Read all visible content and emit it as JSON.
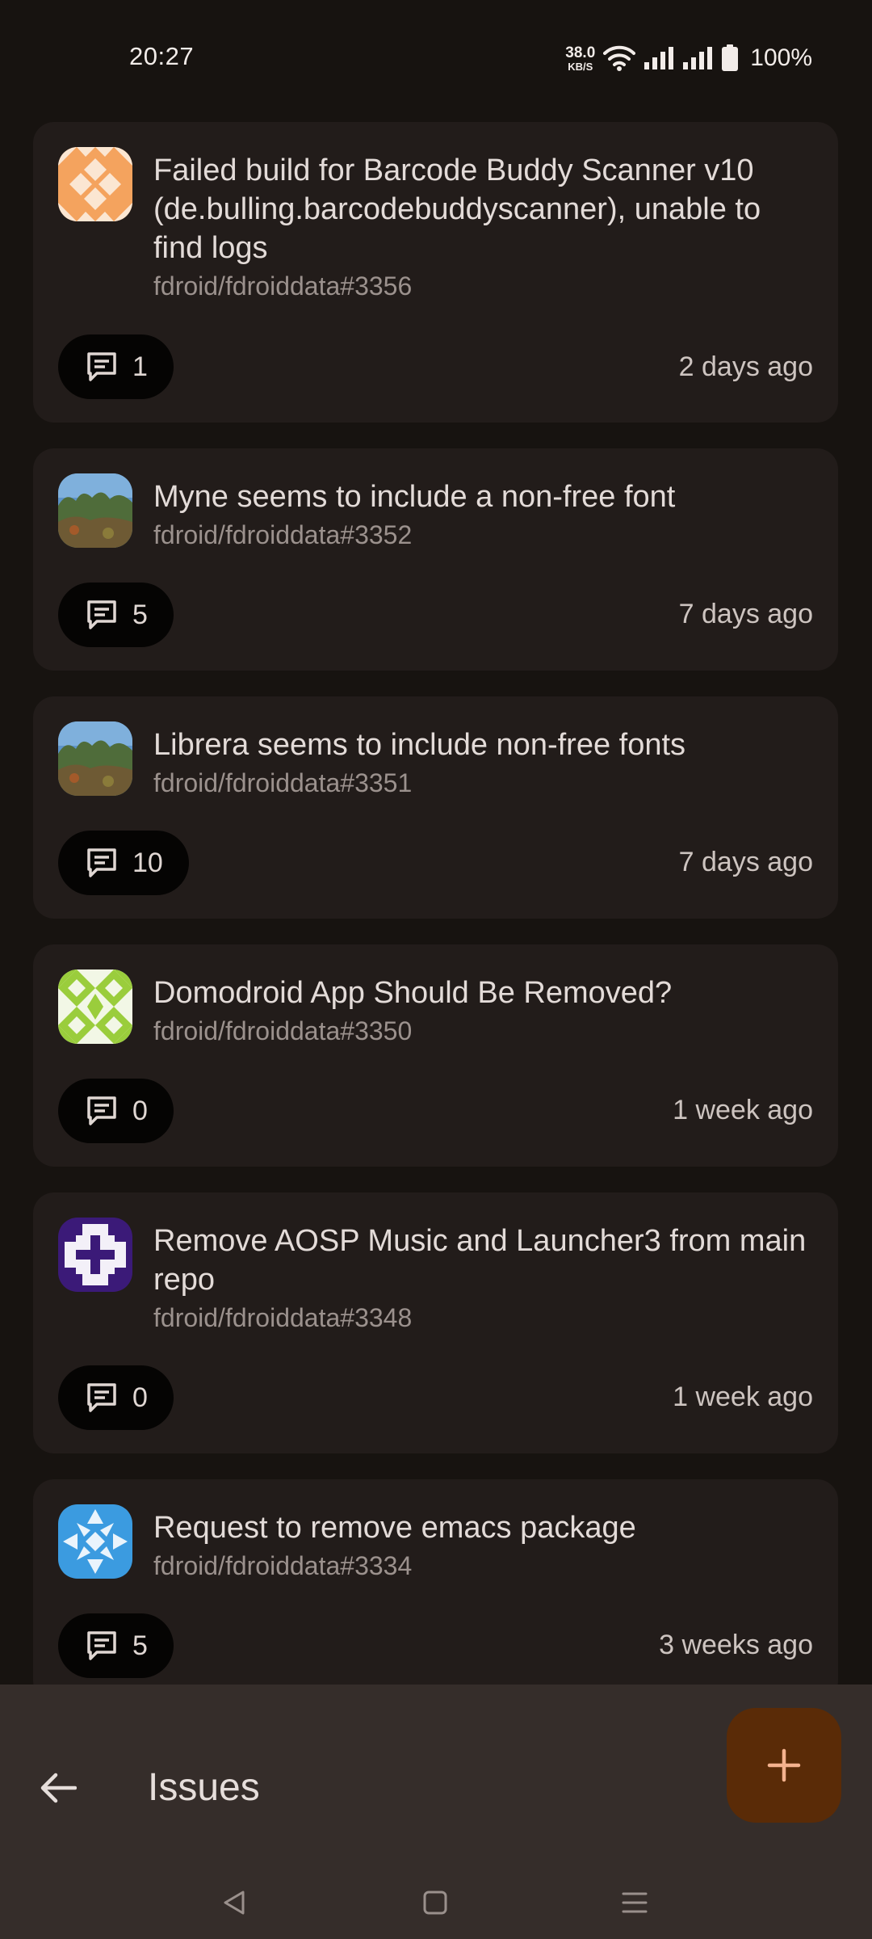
{
  "status_bar": {
    "time": "20:27",
    "net_speed_value": "38.0",
    "net_speed_unit": "KB/S",
    "battery": "100%",
    "icons": [
      "wifi-icon",
      "signal-icon",
      "signal-icon",
      "battery-icon"
    ]
  },
  "issues": [
    {
      "title": "Failed build for Barcode Buddy Scanner v10 (de.bulling.barcodebuddyscanner), unable to find logs",
      "ref": "fdroid/fdroiddata#3356",
      "comments": "1",
      "time": "2 days ago",
      "avatar": "orange-identicon",
      "avatar_color": "#f4a35e"
    },
    {
      "title": "Myne seems to include a non-free font",
      "ref": "fdroid/fdroiddata#3352",
      "comments": "5",
      "time": "7 days ago",
      "avatar": "forest-photo"
    },
    {
      "title": "Librera seems to include non-free fonts",
      "ref": "fdroid/fdroiddata#3351",
      "comments": "10",
      "time": "7 days ago",
      "avatar": "forest-photo"
    },
    {
      "title": "Domodroid App Should Be Removed?",
      "ref": "fdroid/fdroiddata#3350",
      "comments": "0",
      "time": "1 week ago",
      "avatar": "green-identicon",
      "avatar_color": "#9acd3c"
    },
    {
      "title": "Remove AOSP Music and Launcher3 from main repo",
      "ref": "fdroid/fdroiddata#3348",
      "comments": "0",
      "time": "1 week ago",
      "avatar": "purple-identicon",
      "avatar_color": "#3b1a78"
    },
    {
      "title": "Request to remove emacs package",
      "ref": "fdroid/fdroiddata#3334",
      "comments": "5",
      "time": "3 weeks ago",
      "avatar": "blue-identicon",
      "avatar_color": "#3b9be0"
    }
  ],
  "bottom_bar": {
    "title": "Issues",
    "back_icon": "arrow-left-icon",
    "fab_icon": "plus-icon"
  },
  "colors": {
    "background": "#171310",
    "card": "#221c1a",
    "chip": "#050403",
    "bottom_bar": "#352d2a",
    "fab": "#5a2b07",
    "fab_icon": "#f4b28e"
  }
}
